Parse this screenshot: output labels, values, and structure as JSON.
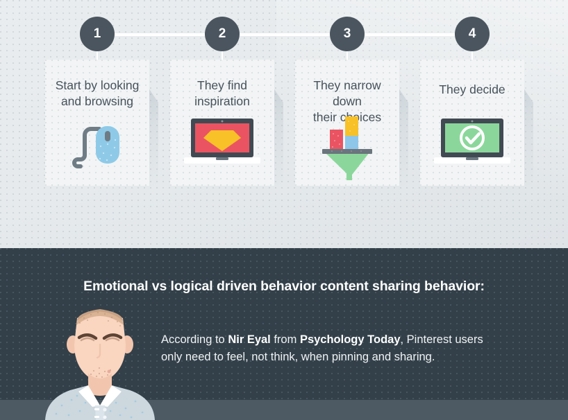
{
  "theme": {
    "background_light": "#e8ecee",
    "card_background": "#f2f4f5",
    "badge_color": "#4a555f",
    "dark_section_color": "#334049",
    "bottom_bar_color": "#4d5a63",
    "title_text_color": "#46525c",
    "timeline_line_color": "#ffffff",
    "accent_red": "#ea5462",
    "accent_yellow": "#f7c127",
    "accent_blue": "#8ec6ea",
    "accent_green": "#8bd79b",
    "mouse_blue": "#8ecae8",
    "laptop_frame": "#414a52"
  },
  "steps": [
    {
      "number": "1",
      "title": "Start by looking\nand browsing",
      "title_line1": "Start by looking",
      "title_line2": "and browsing",
      "icon": "computer-mouse-icon"
    },
    {
      "number": "2",
      "title": "They find\ninspiration",
      "title_line1": "They find",
      "title_line2": "inspiration",
      "icon": "laptop-with-gem-icon"
    },
    {
      "number": "3",
      "title": "They narrow down\ntheir choices",
      "title_line1": "They narrow down",
      "title_line2": "their choices",
      "icon": "funnel-with-bars-icon"
    },
    {
      "number": "4",
      "title": "They decide",
      "title_line1": "They decide",
      "title_line2": "",
      "icon": "laptop-with-checkmark-icon"
    }
  ],
  "dark_section": {
    "heading": "Emotional vs logical driven behavior content sharing behavior:",
    "body": {
      "part1": "According to ",
      "bold1": "Nir Eyal",
      "part2": " from ",
      "bold2": "Psychology Today",
      "part3": ", Pinterest users only need to feel, not think, when pinning and sharing."
    },
    "illustration": "man-portrait-illustration"
  }
}
